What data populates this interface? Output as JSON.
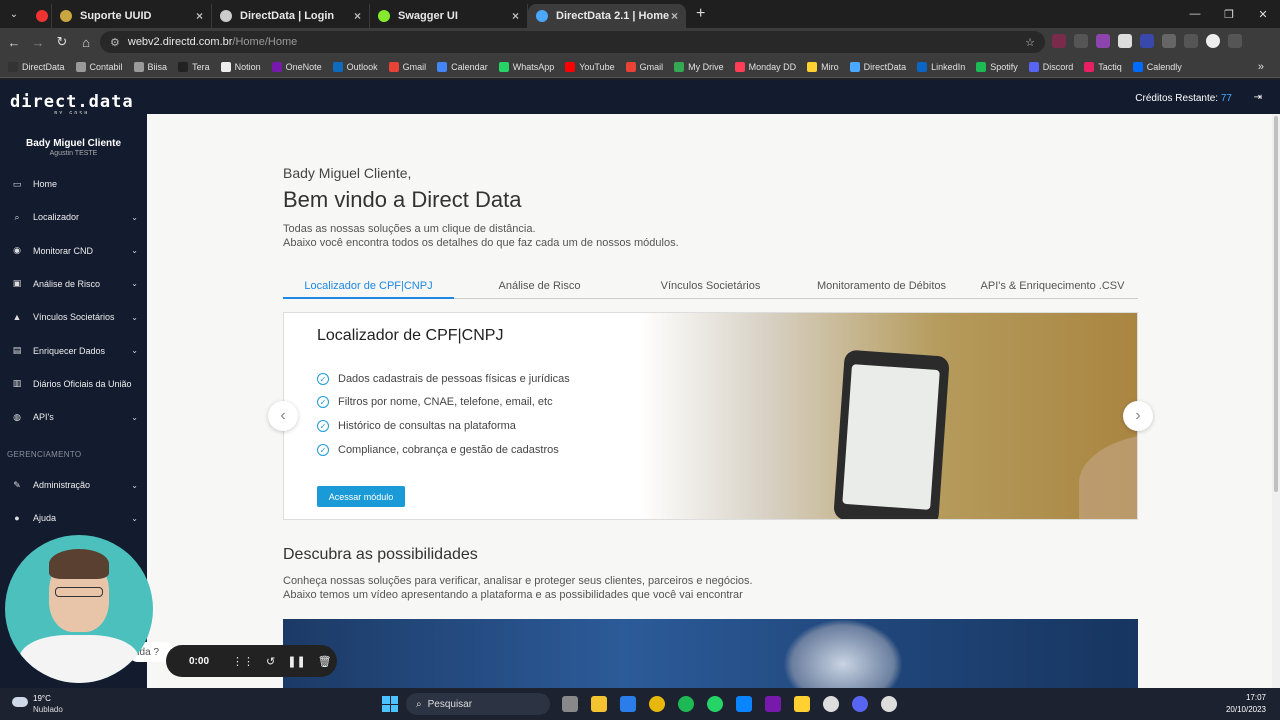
{
  "browser": {
    "tabs": [
      {
        "label": "Suporte UUID",
        "color": "#c9a640"
      },
      {
        "label": "DirectData | Login",
        "color": "#cccccc"
      },
      {
        "label": "Swagger UI",
        "color": "#85ea2d"
      },
      {
        "label": "DirectData 2.1 | Home",
        "color": "#4aa8ff"
      }
    ],
    "url_host": "webv2.directd.com.br",
    "url_path": "/Home/Home",
    "bookmarks": [
      {
        "label": "DirectData",
        "color": "#333333"
      },
      {
        "label": "Contabil",
        "color": "#999999"
      },
      {
        "label": "Biisa",
        "color": "#999999"
      },
      {
        "label": "Tera",
        "color": "#222222"
      },
      {
        "label": "Notion",
        "color": "#eeeeee"
      },
      {
        "label": "OneNote",
        "color": "#7719aa"
      },
      {
        "label": "Outlook",
        "color": "#0f6cbd"
      },
      {
        "label": "Gmail",
        "color": "#ea4335"
      },
      {
        "label": "Calendar",
        "color": "#4285f4"
      },
      {
        "label": "WhatsApp",
        "color": "#25d366"
      },
      {
        "label": "YouTube",
        "color": "#ff0000"
      },
      {
        "label": "Gmail",
        "color": "#ea4335"
      },
      {
        "label": "My Drive",
        "color": "#34a853"
      },
      {
        "label": "Monday DD",
        "color": "#ff3d57"
      },
      {
        "label": "Miro",
        "color": "#ffd02f"
      },
      {
        "label": "DirectData",
        "color": "#4aa8ff"
      },
      {
        "label": "LinkedIn",
        "color": "#0a66c2"
      },
      {
        "label": "Spotify",
        "color": "#1db954"
      },
      {
        "label": "Discord",
        "color": "#5865f2"
      },
      {
        "label": "Tactiq",
        "color": "#e91e63"
      },
      {
        "label": "Calendly",
        "color": "#006bff"
      }
    ]
  },
  "app": {
    "logo": "direct.data",
    "logo_sub": "BY GOSH",
    "credits_label": "Créditos Restante:",
    "credits_value": "77",
    "user_name": "Bady Miguel Cliente",
    "user_sub": "Agustin TESTE",
    "nav": [
      {
        "label": "Home",
        "icon": "monitor-icon",
        "glyph": "▭",
        "chevron": false
      },
      {
        "label": "Localizador",
        "icon": "search-icon",
        "glyph": "⌕",
        "chevron": true
      },
      {
        "label": "Monitorar CND",
        "icon": "eye-icon",
        "glyph": "◉",
        "chevron": true
      },
      {
        "label": "Análise de Risco",
        "icon": "briefcase-icon",
        "glyph": "▣",
        "chevron": true
      },
      {
        "label": "Vínculos Societários",
        "icon": "warning-icon",
        "glyph": "▲",
        "chevron": true
      },
      {
        "label": "Enriquecer Dados",
        "icon": "document-icon",
        "glyph": "▤",
        "chevron": true
      },
      {
        "label": "Diários Oficiais da União",
        "icon": "book-icon",
        "glyph": "▥",
        "chevron": false
      },
      {
        "label": "API's",
        "icon": "globe-icon",
        "glyph": "◍",
        "chevron": true
      }
    ],
    "section_label": "GERENCIAMENTO",
    "nav2": [
      {
        "label": "Administração",
        "icon": "pencil-icon",
        "glyph": "✎",
        "chevron": true
      },
      {
        "label": "Ajuda",
        "icon": "info-icon",
        "glyph": "●",
        "chevron": true
      }
    ]
  },
  "main": {
    "greeting": "Bady Miguel Cliente,",
    "welcome": "Bem vindo a Direct Data",
    "intro_line1": "Todas as nossas soluções a um clique de distância.",
    "intro_line2": "Abaixo você encontra todos os detalhes do que faz cada um de nossos módulos.",
    "tabs": [
      "Localizador de CPF|CNPJ",
      "Análise de Risco",
      "Vínculos Societários",
      "Monitoramento de Débitos",
      "API's & Enriquecimento .CSV"
    ],
    "card_title": "Localizador de CPF|CNPJ",
    "features": [
      "Dados cadastrais de pessoas físicas e jurídicas",
      "Filtros por nome, CNAE, telefone, email, etc",
      "Histórico de consultas na plataforma",
      "Compliance, cobrança e gestão de cadastros"
    ],
    "access_button": "Acessar módulo",
    "discover_title": "Descubra as possibilidades",
    "discover_line1": "Conheça nossas soluções para verificar, analisar e proteger seus clientes, parceiros e negócios.",
    "discover_line2": "Abaixo temos um vídeo apresentando a plataforma e as possibilidades que você vai encontrar"
  },
  "overlay": {
    "help_text": "uda ?",
    "rec_time": "0:00"
  },
  "taskbar": {
    "weather_temp": "19°C",
    "weather_desc": "Nublado",
    "search_placeholder": "Pesquisar",
    "time": "17:07",
    "date": "20/10/2023"
  }
}
